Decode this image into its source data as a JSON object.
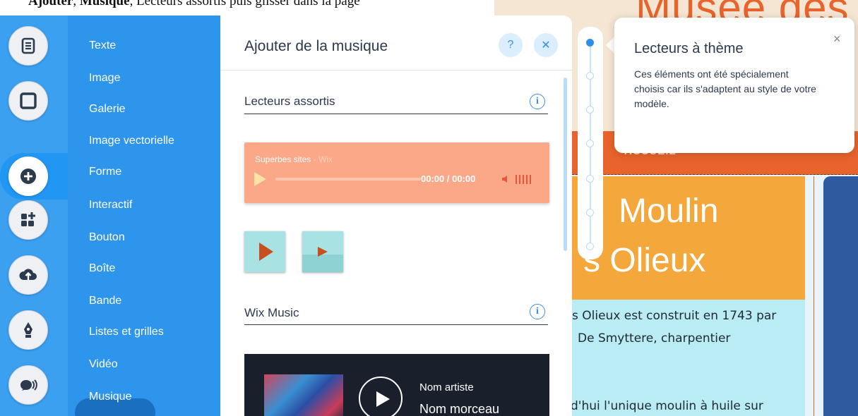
{
  "caption": {
    "bold1": "Ajouter",
    "sep1": ", ",
    "bold2": "Musique",
    "rest": ", Lecteurs assortis puis glisser dans la page"
  },
  "rail": {
    "items": [
      {
        "name": "pages-icon"
      },
      {
        "name": "background-icon"
      },
      {
        "name": "add-icon"
      },
      {
        "name": "apps-icon"
      },
      {
        "name": "upload-icon"
      },
      {
        "name": "blog-icon"
      },
      {
        "name": "chat-icon"
      }
    ]
  },
  "categories": [
    "Texte",
    "Image",
    "Galerie",
    "Image vectorielle",
    "Forme",
    "Interactif",
    "Bouton",
    "Boîte",
    "Bande",
    "Listes et grilles",
    "Vidéo",
    "Musique"
  ],
  "active_category": "Musique",
  "panel": {
    "title": "Ajouter de la musique",
    "help_label": "?",
    "close_label": "✕",
    "section1": "Lecteurs assortis",
    "section2": "Wix Music",
    "info_label": "i"
  },
  "player": {
    "track": "Superbes sites",
    "sep": " - ",
    "artist": "Wix",
    "time": "00:00 / 00:00"
  },
  "wix_music": {
    "artist": "Nom artiste",
    "track": "Nom morceau"
  },
  "tooltip": {
    "title": "Lecteurs à thème",
    "body": "Ces éléments ont été spécialement choisis car ils s'adaptent au style de votre modèle.",
    "close": "×"
  },
  "site": {
    "title": "Musée des M",
    "band_text": "ACCUEIL",
    "heading1": "Moulin",
    "heading2": "s Olieux",
    "para1": "s Olieux est construit en 1743 par",
    "para2": "De Smyttere, charpentier",
    "para3": "d'hui l'unique moulin à huile sur"
  },
  "colors": {
    "rail": "#3ba0f0",
    "panel": "#2e95ec",
    "player": "#fba888",
    "accent": "#e8642c"
  }
}
